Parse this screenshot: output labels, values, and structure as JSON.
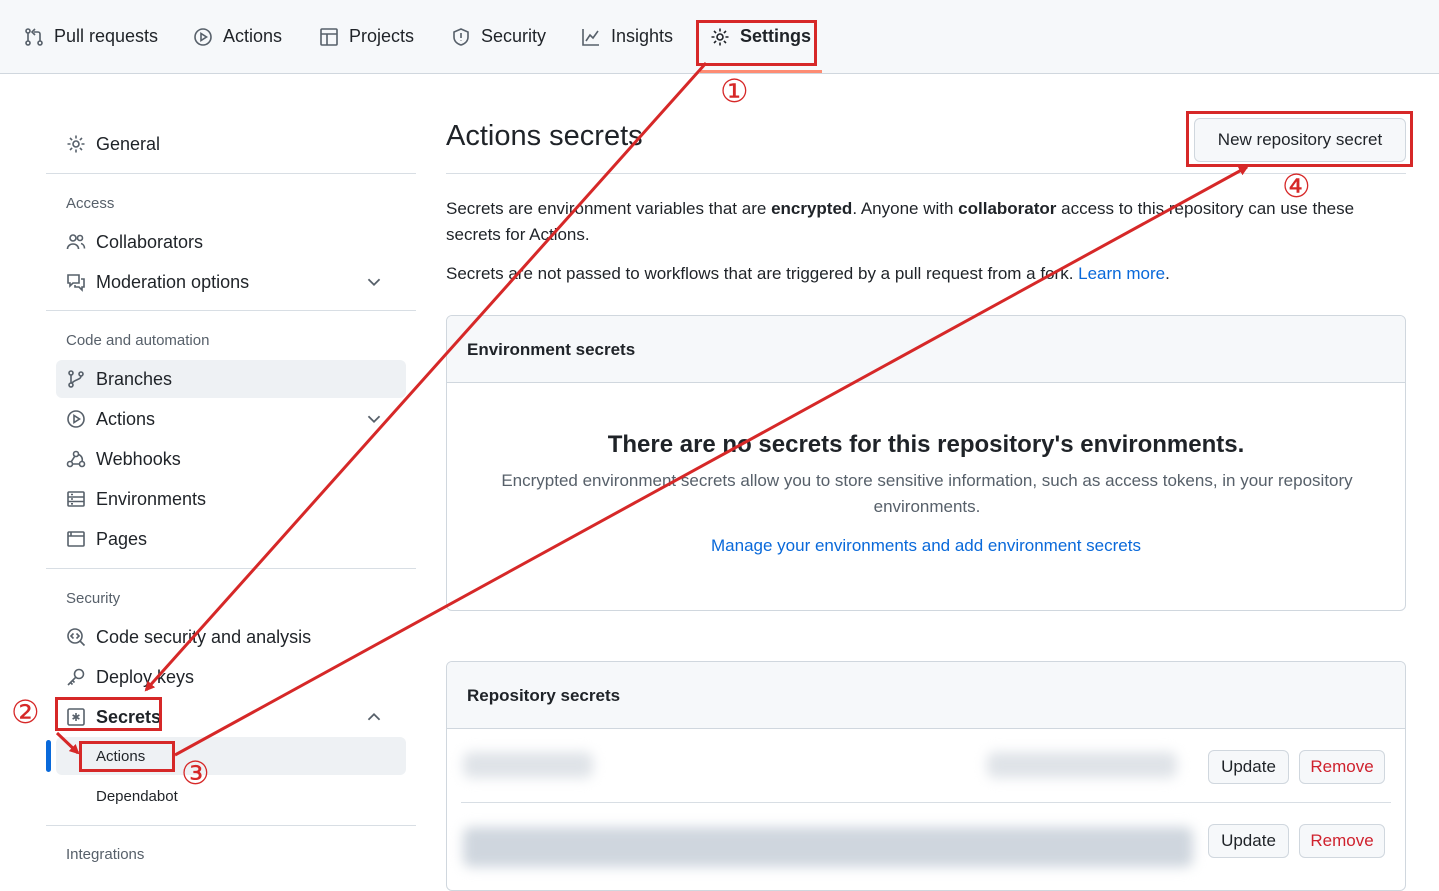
{
  "topnav": {
    "tabs": [
      {
        "label": "Pull requests",
        "icon": "git-pull-request-icon"
      },
      {
        "label": "Actions",
        "icon": "play-circle-icon"
      },
      {
        "label": "Projects",
        "icon": "table-icon"
      },
      {
        "label": "Security",
        "icon": "shield-icon"
      },
      {
        "label": "Insights",
        "icon": "graph-icon"
      },
      {
        "label": "Settings",
        "icon": "gear-icon",
        "active": true
      }
    ]
  },
  "sidebar": {
    "general": "General",
    "sections": {
      "access": "Access",
      "code_automation": "Code and automation",
      "security": "Security",
      "integrations": "Integrations"
    },
    "items": {
      "collaborators": "Collaborators",
      "moderation": "Moderation options",
      "branches": "Branches",
      "actions": "Actions",
      "webhooks": "Webhooks",
      "environments": "Environments",
      "pages": "Pages",
      "code_security": "Code security and analysis",
      "deploy_keys": "Deploy keys",
      "secrets": "Secrets"
    },
    "secrets_sub": {
      "actions": "Actions",
      "dependabot": "Dependabot"
    }
  },
  "main": {
    "title": "Actions secrets",
    "new_secret_button": "New repository secret",
    "intro": {
      "p1_a": "Secrets are environment variables that are ",
      "p1_b": "encrypted",
      "p1_c": ". Anyone with ",
      "p1_d": "collaborator",
      "p1_e": " access to this repository can use these secrets for Actions.",
      "p2_a": "Secrets are not passed to workflows that are triggered by a pull request from a fork. ",
      "p2_link": "Learn more",
      "p2_end": "."
    },
    "env_secrets": {
      "header": "Environment secrets",
      "empty_title": "There are no secrets for this repository's environments.",
      "empty_desc": "Encrypted environment secrets allow you to store sensitive information, such as access tokens, in your repository environments.",
      "manage_link": "Manage your environments and add environment secrets"
    },
    "repo_secrets": {
      "header": "Repository secrets",
      "update_label": "Update",
      "remove_label": "Remove"
    }
  },
  "annotations": {
    "step1": "①",
    "step2": "②",
    "step3": "③",
    "step4": "④",
    "color": "#d62828"
  }
}
